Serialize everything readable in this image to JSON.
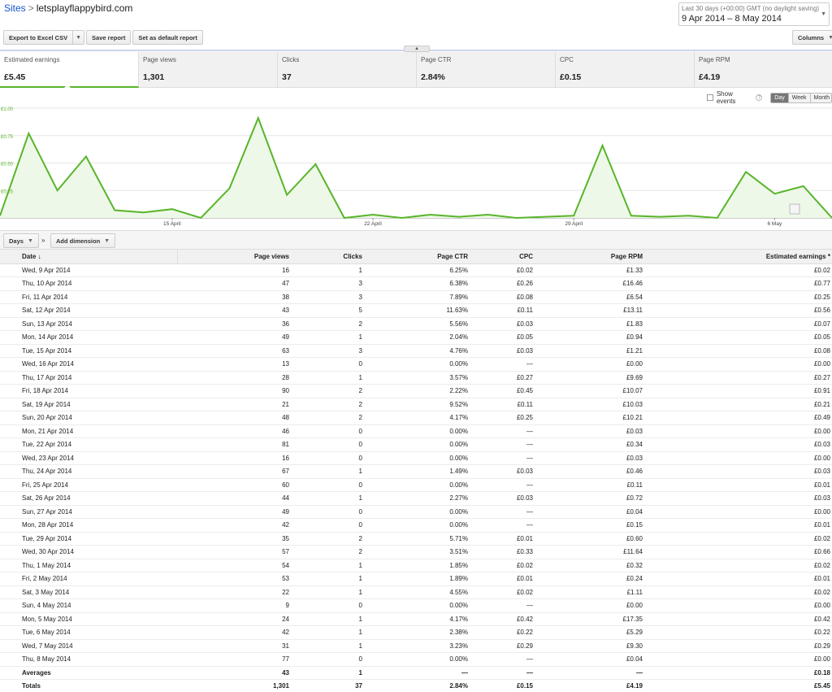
{
  "header": {
    "breadcrumb_link": "Sites",
    "breadcrumb_sep": ">",
    "site_name": "letsplayflappybird.com",
    "date_range_label": "Last 30 days (+00:00) GMT (no daylight saving)",
    "date_range_value": "9 Apr 2014 – 8 May 2014",
    "columns_label": "Columns"
  },
  "toolbar": {
    "export_label": "Export to Excel CSV",
    "save_label": "Save report",
    "default_label": "Set as default report"
  },
  "metrics": [
    {
      "label": "Estimated earnings",
      "value": "£5.45"
    },
    {
      "label": "Page views",
      "value": "1,301"
    },
    {
      "label": "Clicks",
      "value": "37"
    },
    {
      "label": "Page CTR",
      "value": "2.84%"
    },
    {
      "label": "CPC",
      "value": "£0.15"
    },
    {
      "label": "Page RPM",
      "value": "£4.19"
    }
  ],
  "chart_controls": {
    "show_events": "Show events",
    "help": "?",
    "day": "Day",
    "week": "Week",
    "month": "Month"
  },
  "dimension_bar": {
    "days_label": "Days",
    "arrows": "»",
    "add_dimension_label": "Add dimension"
  },
  "colors": {
    "accent_green": "#58b52a",
    "link_blue": "#1155cc"
  },
  "chart_data": {
    "type": "area",
    "ylim": [
      0,
      1.0
    ],
    "y_ticks": [
      "£1.00",
      "£0.75",
      "£0.50",
      "£0.25"
    ],
    "y_tick_values": [
      1.0,
      0.75,
      0.5,
      0.25
    ],
    "x_ticks": [
      "15 April",
      "22 April",
      "29 April",
      "6 May"
    ],
    "x_tick_indices": [
      6,
      13,
      20,
      27
    ],
    "grid": true,
    "series": [
      {
        "values": [
          0.02,
          0.77,
          0.25,
          0.56,
          0.07,
          0.05,
          0.08,
          0.0,
          0.27,
          0.91,
          0.21,
          0.49,
          0.0,
          0.03,
          0.0,
          0.03,
          0.01,
          0.03,
          0.0,
          0.01,
          0.02,
          0.66,
          0.02,
          0.01,
          0.02,
          0.0,
          0.42,
          0.22,
          0.29,
          0.0
        ]
      }
    ]
  },
  "table": {
    "headers": [
      "Date",
      "Page views",
      "Clicks",
      "Page CTR",
      "CPC",
      "Page RPM",
      "Estimated earnings"
    ],
    "sort_glyph": "↓",
    "sorted_glyph": "*",
    "rows": [
      [
        "Wed, 9 Apr 2014",
        "16",
        "1",
        "6.25%",
        "£0.02",
        "£1.33",
        "£0.02"
      ],
      [
        "Thu, 10 Apr 2014",
        "47",
        "3",
        "6.38%",
        "£0.26",
        "£16.46",
        "£0.77"
      ],
      [
        "Fri, 11 Apr 2014",
        "38",
        "3",
        "7.89%",
        "£0.08",
        "£6.54",
        "£0.25"
      ],
      [
        "Sat, 12 Apr 2014",
        "43",
        "5",
        "11.63%",
        "£0.11",
        "£13.11",
        "£0.56"
      ],
      [
        "Sun, 13 Apr 2014",
        "36",
        "2",
        "5.56%",
        "£0.03",
        "£1.83",
        "£0.07"
      ],
      [
        "Mon, 14 Apr 2014",
        "49",
        "1",
        "2.04%",
        "£0.05",
        "£0.94",
        "£0.05"
      ],
      [
        "Tue, 15 Apr 2014",
        "63",
        "3",
        "4.76%",
        "£0.03",
        "£1.21",
        "£0.08"
      ],
      [
        "Wed, 16 Apr 2014",
        "13",
        "0",
        "0.00%",
        "—",
        "£0.00",
        "£0.00"
      ],
      [
        "Thu, 17 Apr 2014",
        "28",
        "1",
        "3.57%",
        "£0.27",
        "£9.69",
        "£0.27"
      ],
      [
        "Fri, 18 Apr 2014",
        "90",
        "2",
        "2.22%",
        "£0.45",
        "£10.07",
        "£0.91"
      ],
      [
        "Sat, 19 Apr 2014",
        "21",
        "2",
        "9.52%",
        "£0.11",
        "£10.03",
        "£0.21"
      ],
      [
        "Sun, 20 Apr 2014",
        "48",
        "2",
        "4.17%",
        "£0.25",
        "£10.21",
        "£0.49"
      ],
      [
        "Mon, 21 Apr 2014",
        "46",
        "0",
        "0.00%",
        "—",
        "£0.03",
        "£0.00"
      ],
      [
        "Tue, 22 Apr 2014",
        "81",
        "0",
        "0.00%",
        "—",
        "£0.34",
        "£0.03"
      ],
      [
        "Wed, 23 Apr 2014",
        "16",
        "0",
        "0.00%",
        "—",
        "£0.03",
        "£0.00"
      ],
      [
        "Thu, 24 Apr 2014",
        "67",
        "1",
        "1.49%",
        "£0.03",
        "£0.46",
        "£0.03"
      ],
      [
        "Fri, 25 Apr 2014",
        "60",
        "0",
        "0.00%",
        "—",
        "£0.11",
        "£0.01"
      ],
      [
        "Sat, 26 Apr 2014",
        "44",
        "1",
        "2.27%",
        "£0.03",
        "£0.72",
        "£0.03"
      ],
      [
        "Sun, 27 Apr 2014",
        "49",
        "0",
        "0.00%",
        "—",
        "£0.04",
        "£0.00"
      ],
      [
        "Mon, 28 Apr 2014",
        "42",
        "0",
        "0.00%",
        "—",
        "£0.15",
        "£0.01"
      ],
      [
        "Tue, 29 Apr 2014",
        "35",
        "2",
        "5.71%",
        "£0.01",
        "£0.60",
        "£0.02"
      ],
      [
        "Wed, 30 Apr 2014",
        "57",
        "2",
        "3.51%",
        "£0.33",
        "£11.64",
        "£0.66"
      ],
      [
        "Thu, 1 May 2014",
        "54",
        "1",
        "1.85%",
        "£0.02",
        "£0.32",
        "£0.02"
      ],
      [
        "Fri, 2 May 2014",
        "53",
        "1",
        "1.89%",
        "£0.01",
        "£0.24",
        "£0.01"
      ],
      [
        "Sat, 3 May 2014",
        "22",
        "1",
        "4.55%",
        "£0.02",
        "£1.11",
        "£0.02"
      ],
      [
        "Sun, 4 May 2014",
        "9",
        "0",
        "0.00%",
        "—",
        "£0.00",
        "£0.00"
      ],
      [
        "Mon, 5 May 2014",
        "24",
        "1",
        "4.17%",
        "£0.42",
        "£17.35",
        "£0.42"
      ],
      [
        "Tue, 6 May 2014",
        "42",
        "1",
        "2.38%",
        "£0.22",
        "£5.29",
        "£0.22"
      ],
      [
        "Wed, 7 May 2014",
        "31",
        "1",
        "3.23%",
        "£0.29",
        "£9.30",
        "£0.29"
      ],
      [
        "Thu, 8 May 2014",
        "77",
        "0",
        "0.00%",
        "—",
        "£0.04",
        "£0.00"
      ]
    ],
    "summary_rows": [
      [
        "Averages",
        "43",
        "1",
        "—",
        "—",
        "—",
        "£0.18"
      ],
      [
        "Totals",
        "1,301",
        "37",
        "2.84%",
        "£0.15",
        "£4.19",
        "£5.45"
      ]
    ]
  }
}
